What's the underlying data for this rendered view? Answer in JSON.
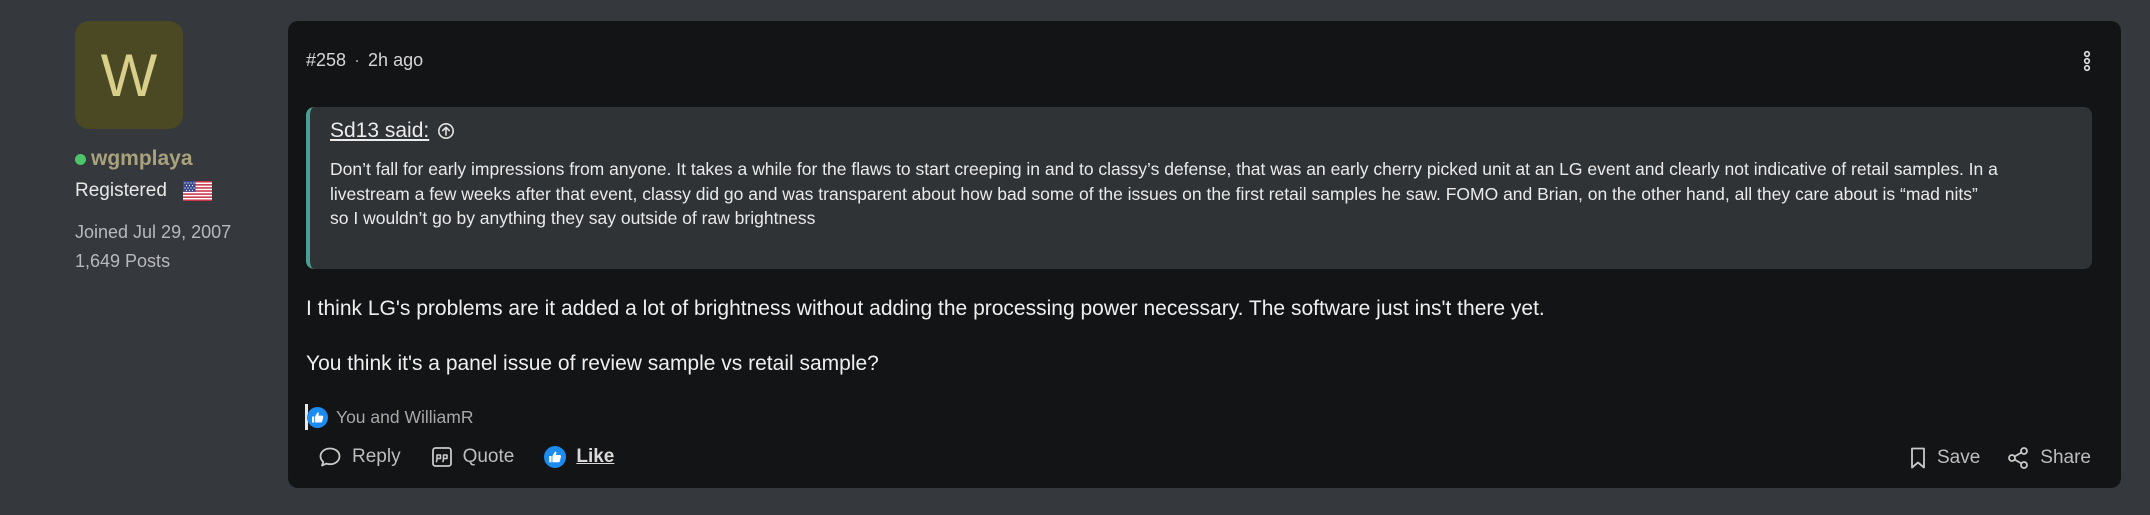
{
  "user": {
    "avatar_letter": "W",
    "avatar_color": "#4b4923",
    "online_color": "#4cc46a",
    "username": "wgmplaya",
    "role": "Registered",
    "flag_icon": "us-flag-icon",
    "joined": "Joined Jul 29, 2007",
    "posts": "1,649 Posts"
  },
  "post": {
    "number": "#258",
    "separator": "·",
    "time": "2h ago",
    "menu_icon": "kebab-menu-icon",
    "quote": {
      "author": "Sd13 said:",
      "lines": [
        "Don’t fall for early impressions from anyone. It takes a while for the flaws to start creeping in and to classy’s defense, that was an early cherry picked unit at an LG event and clearly not indicative of retail samples. In a livestream a few weeks after that event, classy did go and was transparent about how bad some of the issues on the first retail samples he saw. FOMO and Brian, on the other hand, all they care about is “mad nits”",
        "so I wouldn’t go by anything they say outside of raw brightness"
      ]
    },
    "body": [
      "I think LG's problems are it added a lot of brightness without adding the processing power necessary. The software just ins't there yet.",
      "You think it's a panel issue of review sample vs retail sample?"
    ],
    "reactions_text": "You and WilliamR",
    "accent_color": "#4b9e93",
    "like_color": "#1d8cf0"
  },
  "actions": {
    "reply": "Reply",
    "quote": "Quote",
    "like": "Like",
    "save": "Save",
    "share": "Share"
  }
}
